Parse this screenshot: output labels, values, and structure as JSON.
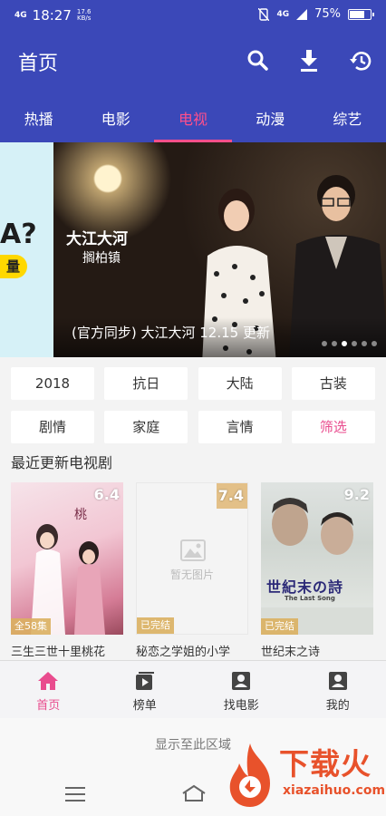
{
  "status_bar": {
    "network": "4G",
    "time": "18:27",
    "speed_value": "17.6",
    "speed_unit": "KB/s",
    "network_right": "4G",
    "battery": "75%",
    "battery_level": 0.75
  },
  "appbar": {
    "title": "首页"
  },
  "tabs": [
    {
      "label": "热播"
    },
    {
      "label": "电影"
    },
    {
      "label": "电视"
    },
    {
      "label": "动漫"
    },
    {
      "label": "综艺"
    }
  ],
  "active_tab": "电视",
  "banner": {
    "peek_question": "A?",
    "peek_button": "量",
    "logo_title": "大江大河",
    "logo_sub": "搁柏镇",
    "caption": "(官方同步) 大江大河 12.15 更新",
    "slides_total": 6,
    "slide_current": 2
  },
  "filters": [
    {
      "label": "2018"
    },
    {
      "label": "抗日"
    },
    {
      "label": "大陆"
    },
    {
      "label": "古装"
    },
    {
      "label": "剧情"
    },
    {
      "label": "家庭"
    },
    {
      "label": "言情"
    },
    {
      "label": "筛选"
    }
  ],
  "section_title": "最近更新电视剧",
  "cards": [
    {
      "title": "三生三世十里桃花",
      "score": "6.4",
      "tag": "全58集"
    },
    {
      "title": "秘恋之学姐的小学",
      "score": "7.4",
      "tag": "已完结",
      "placeholder": "暂无图片"
    },
    {
      "title": "世纪末之诗",
      "score": "9.2",
      "tag": "已完结",
      "poster_title": "世紀末の詩",
      "poster_sub": "The Last Song"
    }
  ],
  "bottom_nav": [
    {
      "label": "首页"
    },
    {
      "label": "榜单"
    },
    {
      "label": "找电影"
    },
    {
      "label": "我的"
    }
  ],
  "hint": "显示至此区域",
  "watermark": {
    "text": "下载火",
    "url": "xiazaihuo.com"
  },
  "colors": {
    "primary": "#3b48b8",
    "accent": "#ff4f8b",
    "pink_text": "#e94c8e"
  }
}
